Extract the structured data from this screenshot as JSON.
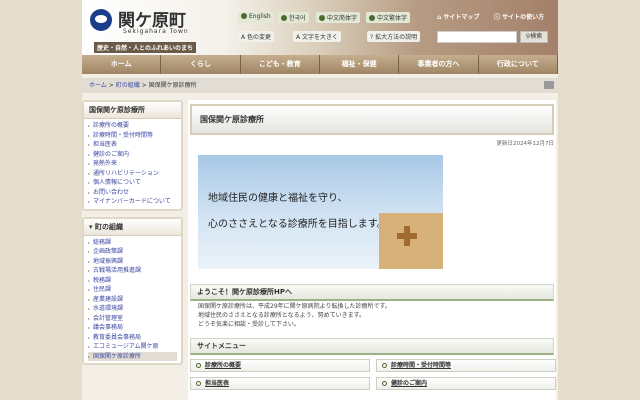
{
  "header": {
    "logo_jp": "関ケ原町",
    "logo_en": "Sekigahara Town",
    "tagline": "歴史・自然・人とのふれあいのまち",
    "languages": [
      "English",
      "한국어",
      "中文简体字",
      "中文繁体字"
    ],
    "links": {
      "sitemap": "サイトマップ",
      "howto": "サイトの使い方"
    },
    "tools": [
      "色の変更",
      "文字を大きく",
      "拡大方法の説明"
    ],
    "search_placeholder": "",
    "search_button": "検索"
  },
  "nav": [
    "ホーム",
    "くらし",
    "こども・教育",
    "福祉・保健",
    "事業者の方へ",
    "行政について"
  ],
  "breadcrumb": {
    "items": [
      "ホーム",
      "町の組織"
    ],
    "current": "国保関ケ原診療所",
    "sep": ">"
  },
  "sidebar": {
    "section1": {
      "title": "国保関ケ原診療所",
      "items": [
        "診療所の概要",
        "診療時間・受付時間等",
        "担当医表",
        "健診のご案内",
        "発熱外来",
        "通所リハビリテーション",
        "個人情報について",
        "お問い合わせ",
        "マイナンバーカードについて"
      ]
    },
    "section2": {
      "title": "町の組織",
      "items": [
        "総務課",
        "企画政策課",
        "地域振興課",
        "古戦場活用推進課",
        "税務課",
        "住民課",
        "産業建設課",
        "水道環境課",
        "会計管理室",
        "議会事務局",
        "教育委員会事務局",
        "エコミュージアム関ケ原",
        "国保関ケ原診療所"
      ],
      "current": "国保関ケ原診療所"
    }
  },
  "main": {
    "title": "国保関ケ原診療所",
    "updated": "更新日2024年12月7日",
    "banner": [
      "地域住民の健康と福祉を守り、",
      "心のささえとなる診療所を目指します。"
    ],
    "welcome_title": "ようこそ！関ケ原診療所HPへ",
    "welcome_lines": [
      "国保関ケ原診療所は、平成29年に関ケ原病院より転換した診療所です。",
      "地域住民のささえとなる診療所となるよう、努めていきます。",
      "どうぞ気楽に相談・受診して下さい。"
    ],
    "menu_title": "サイトメニュー",
    "menu": [
      "診療所の概要",
      "診療時間・受付時間等",
      "担当医表",
      "健診のご案内"
    ]
  }
}
